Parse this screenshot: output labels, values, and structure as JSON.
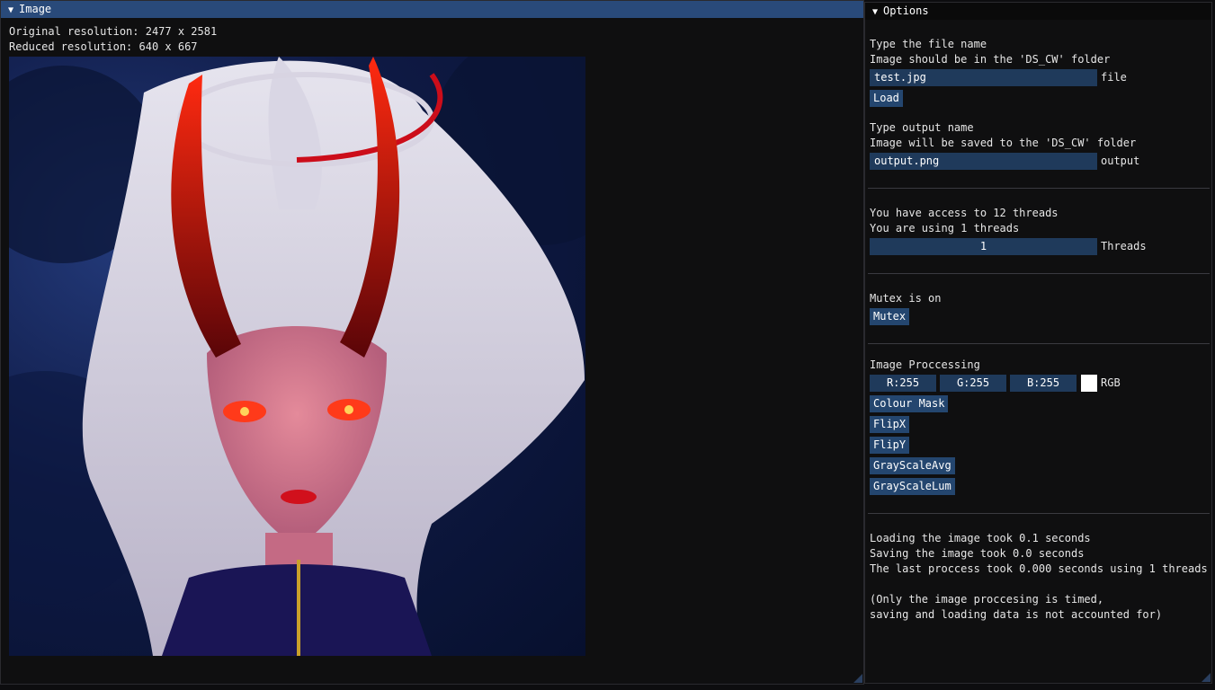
{
  "image_window": {
    "title": "Image",
    "original_resolution": "Original resolution: 2477 x 2581",
    "reduced_resolution": "Reduced resolution: 640 x 667"
  },
  "options_window": {
    "title": "Options",
    "file": {
      "prompt": "Type the file name",
      "hint": "Image should be in the 'DS_CW' folder",
      "value": "test.jpg",
      "label": "file",
      "load_button": "Load"
    },
    "output": {
      "prompt": "Type output name",
      "hint": "Image will be saved to the 'DS_CW' folder",
      "value": "output.png",
      "label": "output"
    },
    "threads": {
      "access": "You have access to 12 threads",
      "using": "You are using 1 threads",
      "value": "1",
      "label": "Threads"
    },
    "mutex": {
      "status": "Mutex is on",
      "button": "Mutex"
    },
    "processing": {
      "title": "Image Proccessing",
      "r": "R:255",
      "g": "G:255",
      "b": "B:255",
      "rgb_label": "RGB",
      "swatch_color": "#ffffff",
      "buttons": {
        "colour_mask": "Colour Mask",
        "flipx": "FlipX",
        "flipy": "FlipY",
        "grayscale_avg": "GrayScaleAvg",
        "grayscale_lum": "GrayScaleLum"
      }
    },
    "timing": {
      "loading": "Loading the image took 0.1 seconds",
      "saving": "Saving the image took 0.0 seconds",
      "last_process": "The last proccess took 0.000 seconds using 1 threads",
      "note_line1": "(Only the image proccesing is timed,",
      "note_line2": "saving and loading data is not accounted for)"
    }
  },
  "colors": {
    "accent_titlebar": "#294a7a",
    "button": "#24466f",
    "field": "#1f3a5b",
    "background": "#0f0f10"
  }
}
